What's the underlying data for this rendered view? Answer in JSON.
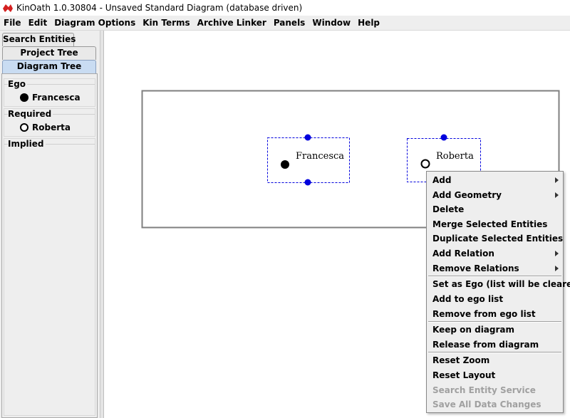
{
  "window": {
    "title": "KinOath 1.0.30804 - Unsaved Standard Diagram (database driven)",
    "app_icon": "kinoath-app-icon"
  },
  "menubar": {
    "items": [
      "File",
      "Edit",
      "Diagram Options",
      "Kin Terms",
      "Archive Linker",
      "Panels",
      "Window",
      "Help"
    ]
  },
  "left_panel": {
    "tabs": [
      "Search Entities",
      "Project Tree",
      "Diagram Tree"
    ],
    "selected_tab": "Diagram Tree",
    "groups": {
      "ego": {
        "label": "Ego",
        "entities": [
          {
            "name": "Francesca",
            "symbol": "filled-circle"
          }
        ]
      },
      "required": {
        "label": "Required",
        "entities": [
          {
            "name": "Roberta",
            "symbol": "open-circle"
          }
        ]
      },
      "implied": {
        "label": "Implied",
        "entities": []
      }
    }
  },
  "diagram": {
    "entities": [
      {
        "name": "Francesca",
        "symbol": "filled-circle",
        "selected": true
      },
      {
        "name": "Roberta",
        "symbol": "open-circle",
        "selected": true
      }
    ],
    "selection_color": "#0000dd"
  },
  "context_menu": {
    "items": [
      {
        "label": "Add",
        "submenu": true,
        "enabled": true
      },
      {
        "label": "Add Geometry",
        "submenu": true,
        "enabled": true
      },
      {
        "label": "Delete",
        "submenu": false,
        "enabled": true
      },
      {
        "label": "Merge Selected Entities",
        "submenu": false,
        "enabled": true
      },
      {
        "label": "Duplicate Selected Entities",
        "submenu": false,
        "enabled": true
      },
      {
        "label": "Add Relation",
        "submenu": true,
        "enabled": true
      },
      {
        "label": "Remove Relations",
        "submenu": true,
        "enabled": true
      },
      {
        "label": "Set as Ego (list will be cleared)",
        "submenu": false,
        "enabled": true
      },
      {
        "label": "Add to ego list",
        "submenu": false,
        "enabled": true
      },
      {
        "label": "Remove from ego list",
        "submenu": false,
        "enabled": true
      },
      {
        "label": "Keep on diagram",
        "submenu": false,
        "enabled": true
      },
      {
        "label": "Release from diagram",
        "submenu": false,
        "enabled": true
      },
      {
        "label": "Reset Zoom",
        "submenu": false,
        "enabled": true
      },
      {
        "label": "Reset Layout",
        "submenu": false,
        "enabled": true
      },
      {
        "label": "Search Entity Service",
        "submenu": false,
        "enabled": false
      },
      {
        "label": "Save All Data Changes",
        "submenu": false,
        "enabled": false
      }
    ]
  }
}
